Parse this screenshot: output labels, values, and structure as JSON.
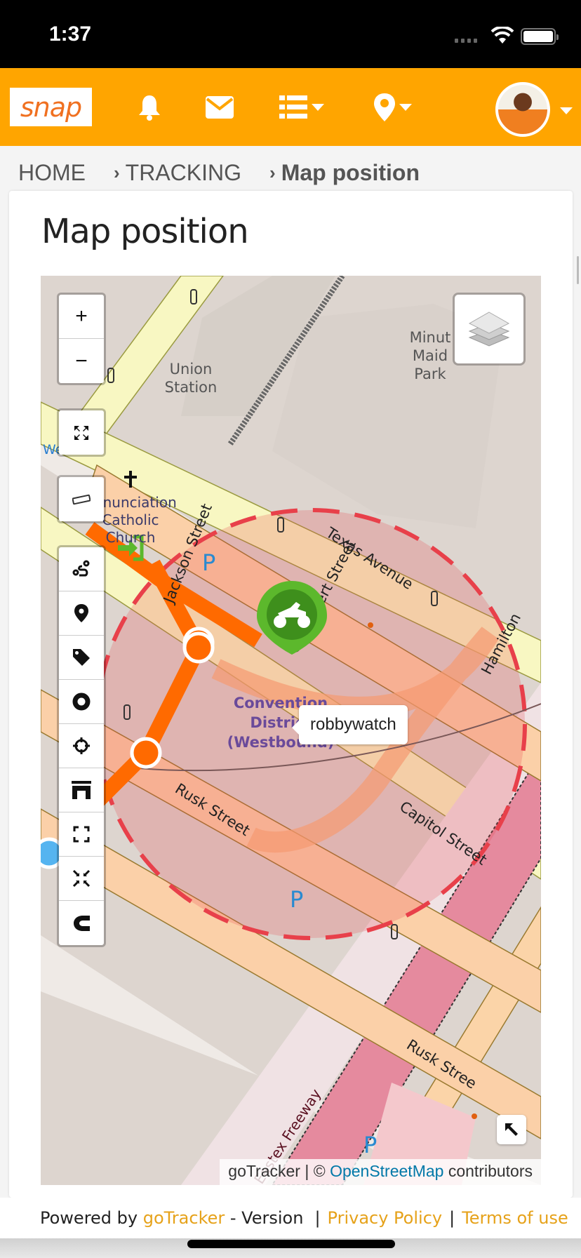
{
  "status_bar": {
    "time": "1:37",
    "wifi_icon": "wifi-icon",
    "battery_icon": "battery-icon"
  },
  "navbar": {
    "logo_text": "snap",
    "icons": [
      "bell-icon",
      "envelope-icon",
      "list-icon",
      "map-marker-icon"
    ],
    "avatar": "user-avatar",
    "brand_color": "#FFA500"
  },
  "breadcrumb": {
    "items": [
      "HOME",
      "TRACKING",
      "Map position"
    ]
  },
  "page": {
    "title": "Map position"
  },
  "map": {
    "controls": {
      "zoom_in": "+",
      "zoom_out": "−",
      "toolbar_icons": [
        "fullscreen-icon",
        "ruler-icon",
        "route-icon",
        "map-marker-icon",
        "tag-icon",
        "circle-icon",
        "crosshairs-icon",
        "archway-icon",
        "expand-icon",
        "compress-icon",
        "magnet-icon"
      ]
    },
    "layers_icon": "layers-icon",
    "labels": {
      "union_station": "Union Station",
      "minute_maid": "Minute Maid Park",
      "church": "Annunciation Catholic Church",
      "westin": "Westin",
      "jackson": "Jackson Street",
      "texas": "Texas Avenue",
      "hamilton": "Hamilton",
      "chenevert": "Chenevert Street",
      "convention": "Convention District (Westbound)",
      "capitol": "Capitol Street",
      "rusk": "Rusk Street",
      "rusk2": "Rusk Street",
      "eastex": "Eastex Freeway",
      "parking": "P"
    },
    "marker": {
      "device_name": "robbywatch",
      "icon": "motorcycle-icon",
      "color": "#4CA01F"
    },
    "geofence_color": "#E8404A",
    "track_color": "#FF6A00",
    "attribution": {
      "prefix": "goTracker | ©",
      "link": "OpenStreetMap",
      "suffix": "contributors"
    },
    "collapse_icon": "arrow-up-left-icon"
  },
  "footer": {
    "powered_by": "Powered by",
    "brand_link": "goTracker",
    "version": "- Version",
    "privacy": "Privacy Policy",
    "terms": "Terms of use",
    "link_color": "#E6A21A"
  }
}
